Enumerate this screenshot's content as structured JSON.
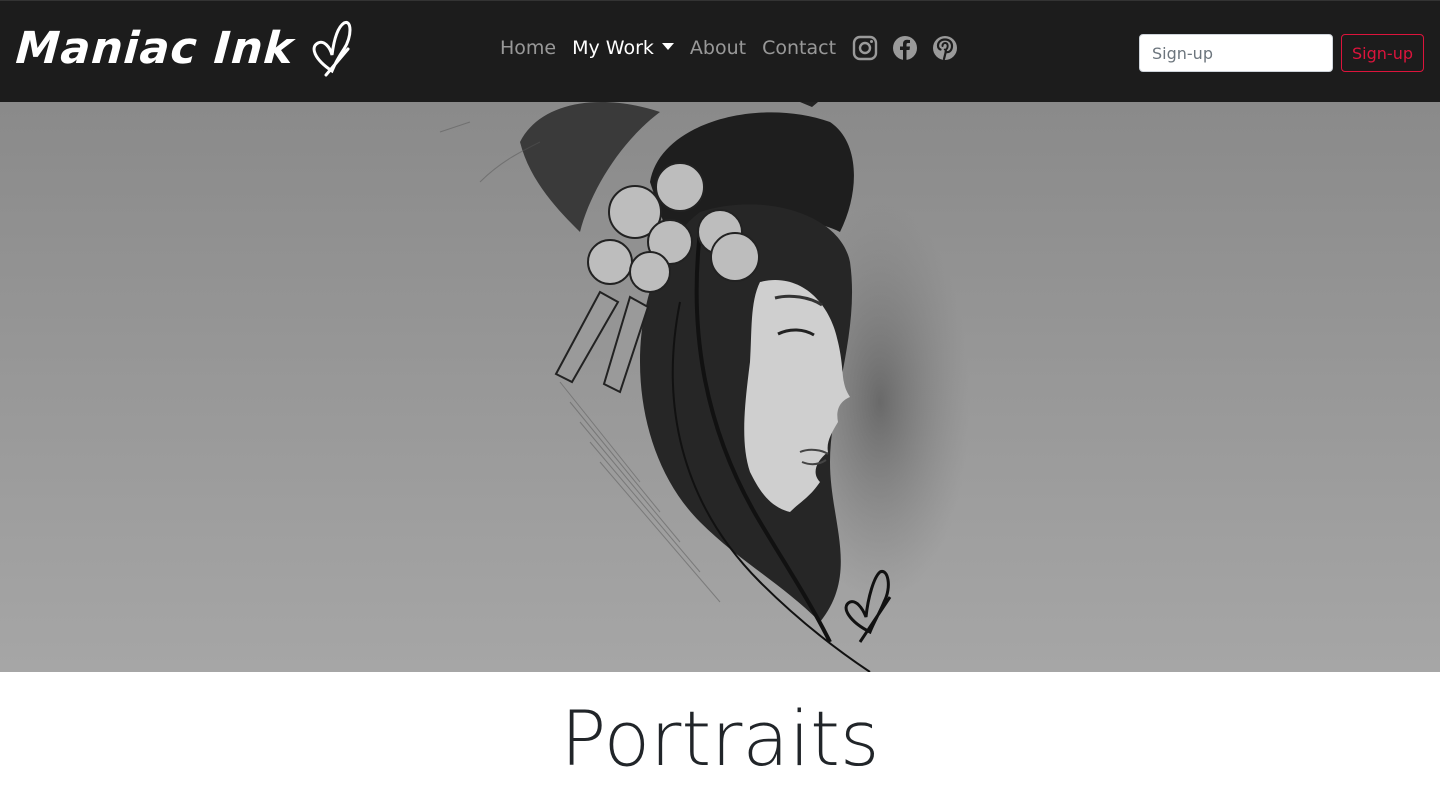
{
  "brand": {
    "name": "Maniac Ink"
  },
  "nav": {
    "home": "Home",
    "my_work": "My Work",
    "about": "About",
    "contact": "Contact"
  },
  "social": [
    "instagram-icon",
    "facebook-icon",
    "pinterest-icon"
  ],
  "signup": {
    "placeholder": "Sign-up",
    "button_label": "Sign-up"
  },
  "hero": {
    "artwork": "geisha-portrait-sketch"
  },
  "section": {
    "title": "Portraits"
  },
  "colors": {
    "navbar_bg": "#1c1c1c",
    "accent": "#dc143c",
    "hero_bg": "#999999"
  }
}
